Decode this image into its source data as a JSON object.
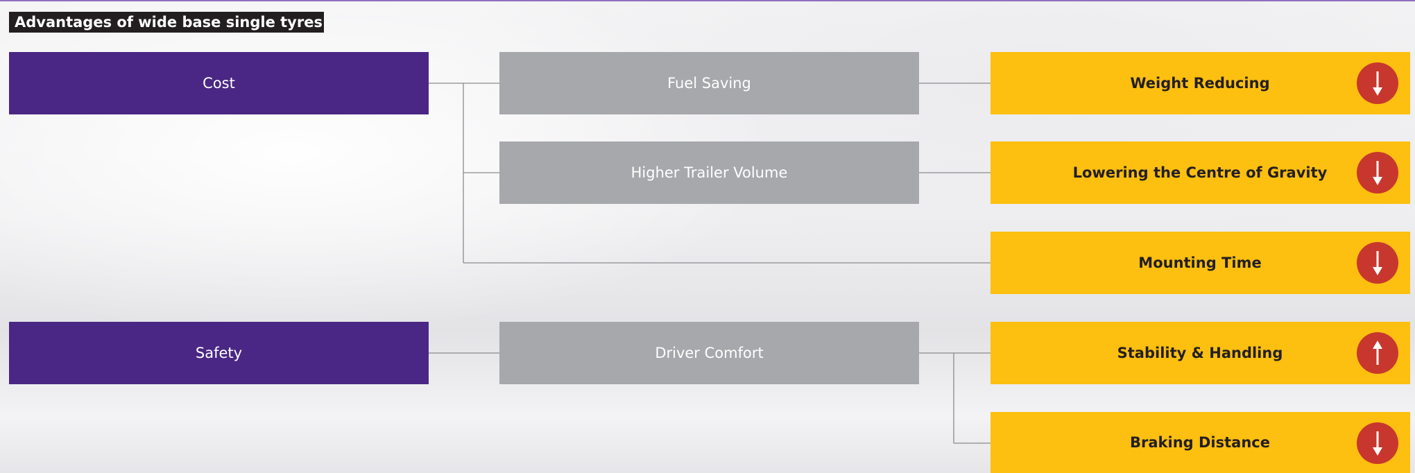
{
  "title": "Advantages of wide base single tyres",
  "categories": [
    {
      "id": "cost",
      "label": "Cost"
    },
    {
      "id": "safety",
      "label": "Safety"
    }
  ],
  "factors": [
    {
      "id": "fuel",
      "label": "Fuel Saving"
    },
    {
      "id": "volume",
      "label": "Higher Trailer Volume"
    },
    {
      "id": "comfort",
      "label": "Driver Comfort"
    }
  ],
  "outcomes": [
    {
      "id": "weight",
      "label": "Weight Reducing",
      "direction": "down"
    },
    {
      "id": "gravity",
      "label": "Lowering the Centre of Gravity",
      "direction": "down"
    },
    {
      "id": "mounting",
      "label": "Mounting Time",
      "direction": "down"
    },
    {
      "id": "stability",
      "label": "Stability & Handling",
      "direction": "up"
    },
    {
      "id": "braking",
      "label": "Braking Distance",
      "direction": "down"
    }
  ],
  "colors": {
    "category": "#4a2784",
    "factor": "#a7a8ab",
    "outcome": "#fdbf10",
    "badge": "#c8372d",
    "connector": "#8a8a8e"
  }
}
